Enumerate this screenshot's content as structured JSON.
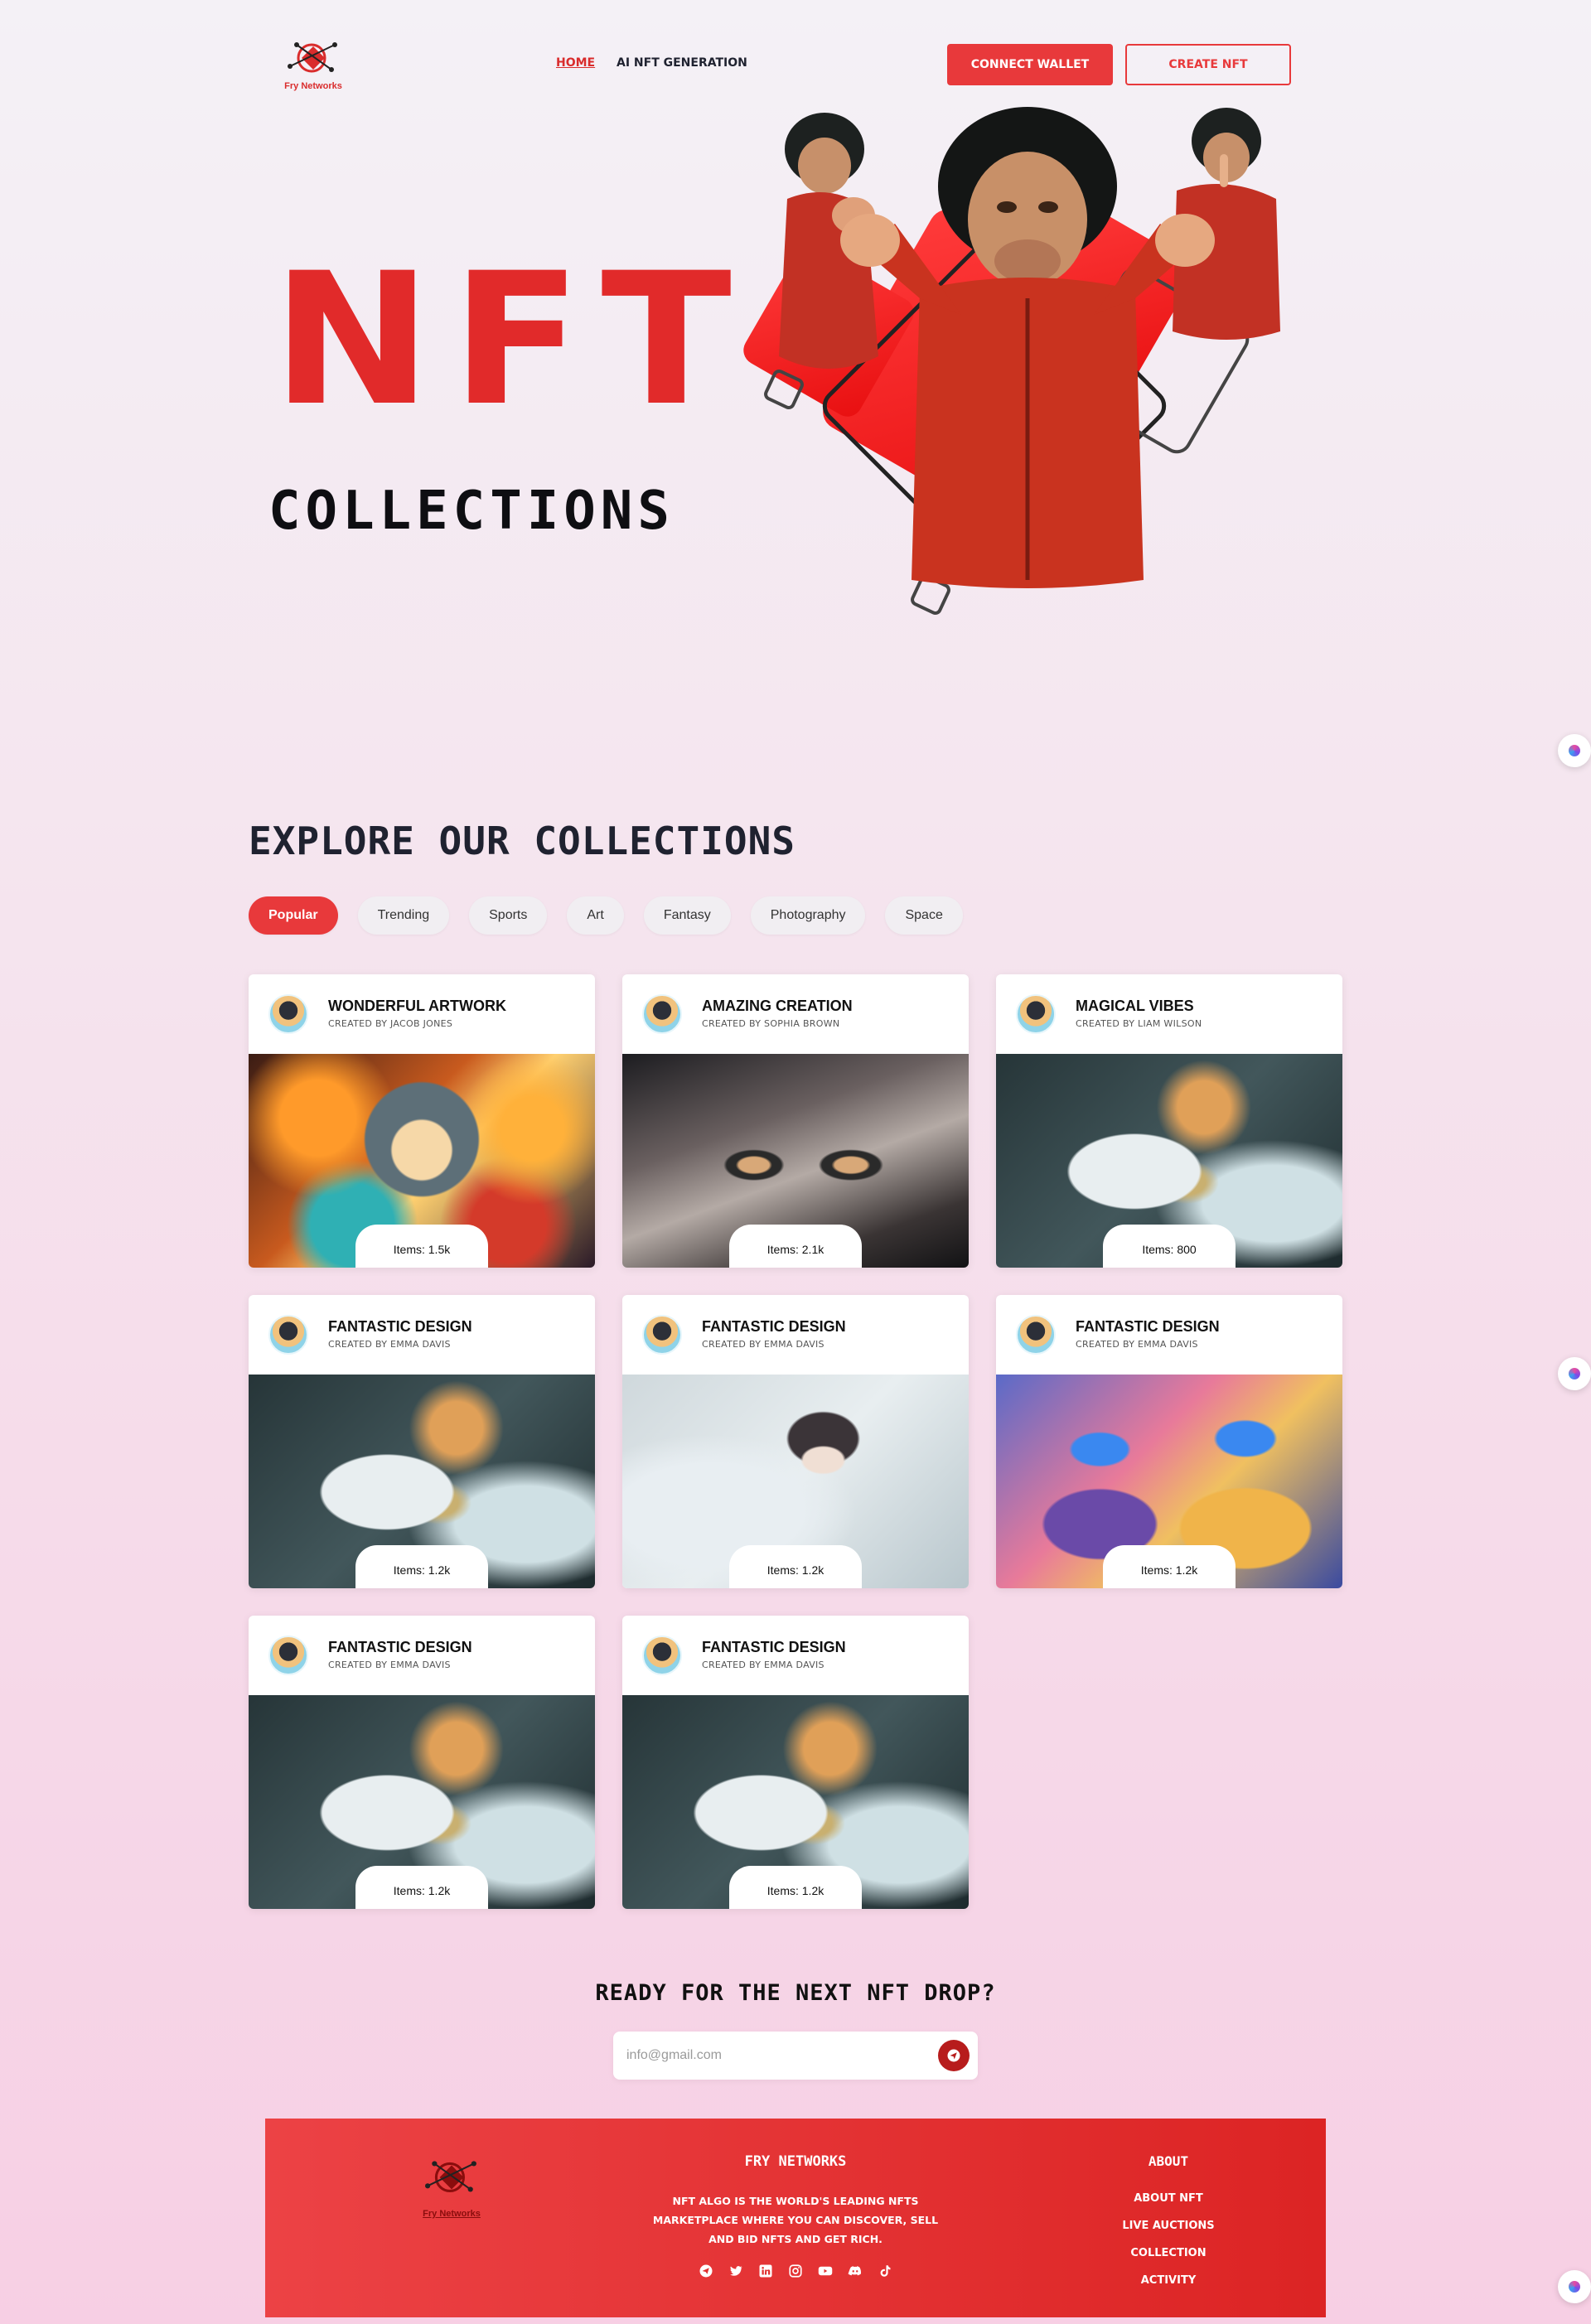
{
  "brand": {
    "name": "Fry Networks",
    "accent": "#e8393b"
  },
  "nav": {
    "links": [
      "HOME",
      "AI NFT GENERATION"
    ],
    "connect_wallet": "CONNECT WALLET",
    "create_nft": "CREATE NFT"
  },
  "hero": {
    "title": "NFT",
    "subtitle": "COLLECTIONS"
  },
  "explore": {
    "title": "EXPLORE OUR COLLECTIONS",
    "tabs": [
      "Popular",
      "Trending",
      "Sports",
      "Art",
      "Fantasy",
      "Photography",
      "Space"
    ],
    "active_tab": "Popular",
    "cards": [
      {
        "title": "WONDERFUL ARTWORK",
        "creator": "CREATED BY JACOB JONES",
        "items": "Items: 1.5k"
      },
      {
        "title": "AMAZING CREATION",
        "creator": "CREATED BY SOPHIA BROWN",
        "items": "Items: 2.1k"
      },
      {
        "title": "MAGICAL VIBES",
        "creator": "CREATED BY LIAM WILSON",
        "items": "Items: 800"
      },
      {
        "title": "FANTASTIC DESIGN",
        "creator": "CREATED BY EMMA DAVIS",
        "items": "Items: 1.2k"
      },
      {
        "title": "FANTASTIC DESIGN",
        "creator": "CREATED BY EMMA DAVIS",
        "items": "Items: 1.2k"
      },
      {
        "title": "FANTASTIC DESIGN",
        "creator": "CREATED BY EMMA DAVIS",
        "items": "Items: 1.2k"
      },
      {
        "title": "FANTASTIC DESIGN",
        "creator": "CREATED BY EMMA DAVIS",
        "items": "Items: 1.2k"
      },
      {
        "title": "FANTASTIC DESIGN",
        "creator": "CREATED BY EMMA DAVIS",
        "items": "Items: 1.2k"
      }
    ]
  },
  "newsletter": {
    "title": "READY FOR THE NEXT NFT DROP?",
    "placeholder": "info@gmail.com",
    "send_icon": "send-icon"
  },
  "footer": {
    "brand": "FRY NETWORKS",
    "logo_text": "Fry Networks",
    "description": "NFT ALGO IS THE WORLD'S LEADING NFTS MARKETPLACE WHERE YOU CAN DISCOVER, SELL AND BID NFTS AND GET RICH.",
    "social_icons": [
      "telegram-icon",
      "twitter-icon",
      "linkedin-icon",
      "instagram-icon",
      "youtube-icon",
      "discord-icon",
      "tiktok-icon"
    ],
    "about_title": "ABOUT",
    "links": [
      "ABOUT NFT",
      "LIVE AUCTIONS",
      "COLLECTION",
      "ACTIVITY"
    ]
  }
}
